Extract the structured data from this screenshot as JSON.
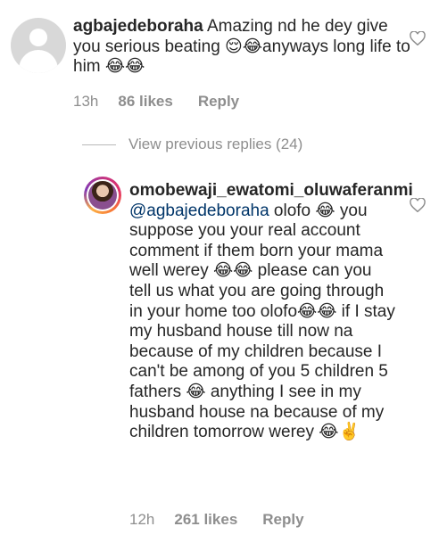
{
  "comment1": {
    "username": "agbajedeboraha",
    "text": " Amazing nd he dey give you serious beating 😌😂anyways long life to him 😂😂",
    "time": "13h",
    "likes": "86 likes",
    "reply": "Reply",
    "avatar_icon": "default-avatar-icon",
    "like_icon": "heart-outline-icon"
  },
  "view_replies": {
    "label": "View previous replies (24)"
  },
  "comment2": {
    "username": "omobewaji_ewatomi_oluwaferanmi",
    "mention": "@agbajedeboraha",
    "text": "olofo 😂 you suppose you your real account comment if them born your mama well werey 😂😂 please can you tell us what you are going through in your home too olofo😂😂 if I stay my husband house till now na because of my children because I can't be among of you 5 children 5 fathers 😂 anything I see in my husband house na because of my children tomorrow werey 😂✌️",
    "time": "12h",
    "likes": "261 likes",
    "reply": "Reply",
    "avatar_icon": "profile-photo-avatar",
    "like_icon": "heart-outline-icon"
  },
  "colors": {
    "text": "#262626",
    "meta": "#8e8e8e",
    "mention": "#003569"
  }
}
